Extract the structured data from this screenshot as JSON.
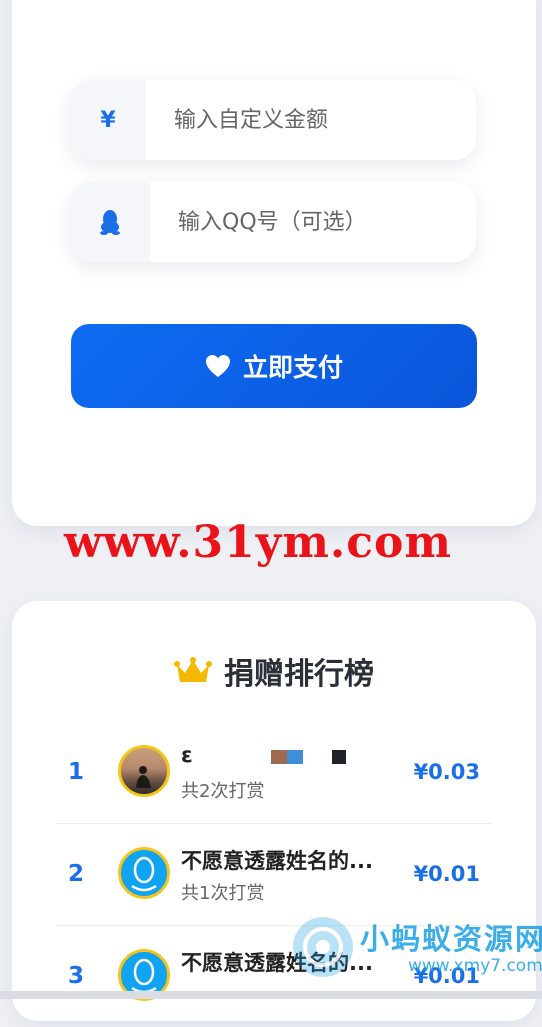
{
  "form": {
    "currency_symbol": "¥",
    "amount_placeholder": "输入自定义金额",
    "qq_placeholder": "输入QQ号（可选）",
    "pay_label": "立即支付"
  },
  "watermark": {
    "site": "www.31ym.com",
    "brand": "小蚂蚁资源网",
    "brand_url": "www.xmy7.com"
  },
  "ranking": {
    "title": "捐赠排行榜",
    "items": [
      {
        "rank": "1",
        "name": "ε",
        "count_label": "共2次打赏",
        "amount": "¥0.03",
        "avatar": "photo-avatar"
      },
      {
        "rank": "2",
        "name": "不愿意透露姓名的...",
        "count_label": "共1次打赏",
        "amount": "¥0.01",
        "avatar": "qq-avatar"
      },
      {
        "rank": "3",
        "name": "不愿意透露姓名的...",
        "count_label": "",
        "amount": "¥0.01",
        "avatar": "qq-avatar"
      }
    ]
  },
  "colors": {
    "accent": "#1a6fe8",
    "watermark_red": "#e8141a",
    "crown": "#f5b800",
    "avatar_border": "#f5c518"
  }
}
